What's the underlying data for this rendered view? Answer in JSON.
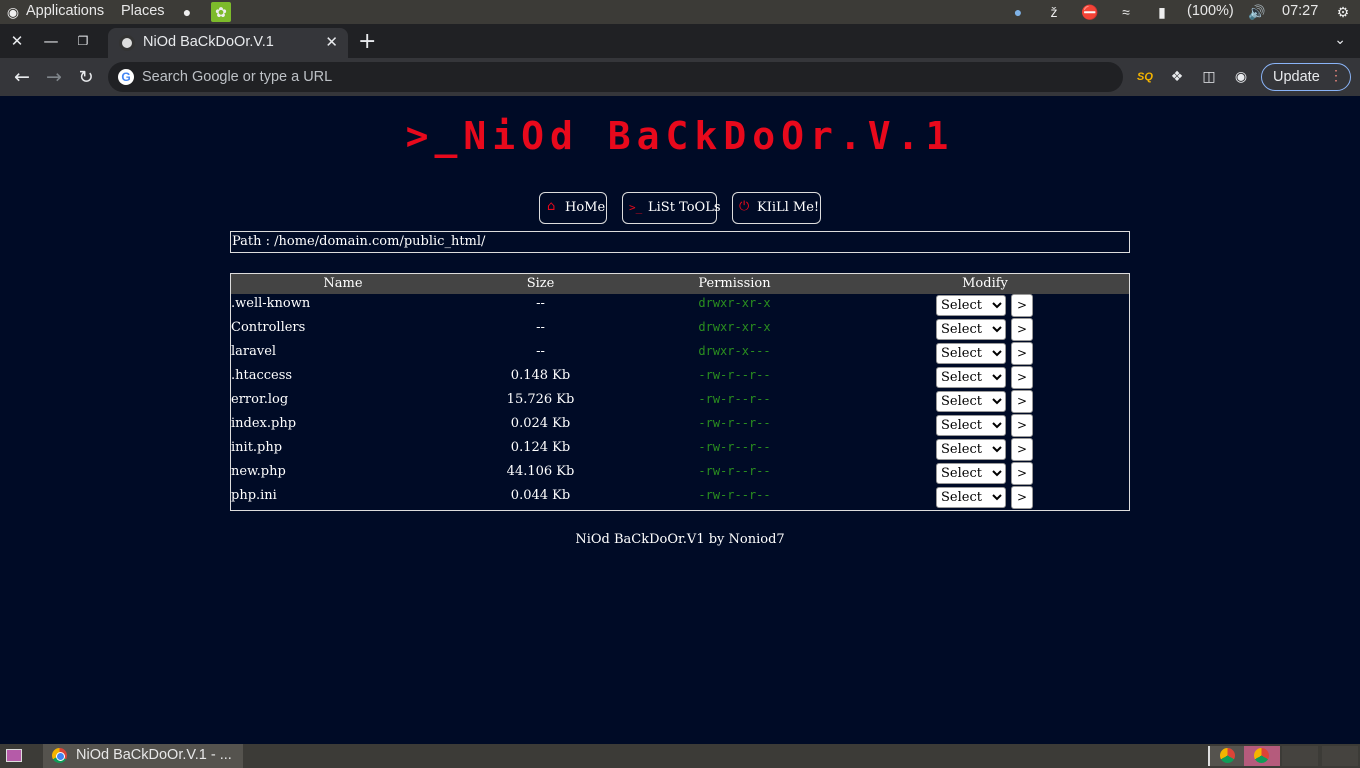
{
  "system_panel": {
    "applications_label": "Applications",
    "places_label": "Places",
    "battery_label": "(100%)",
    "clock": "07:27"
  },
  "browser": {
    "tab_title": "NiOd BaCkDoOr.V.1",
    "omnibox_placeholder": "Search Google or type a URL",
    "update_label": "Update",
    "extension_sq_label": "SQ"
  },
  "page": {
    "logo": ">_NiOd BaCkDoOr.V.1",
    "menu": [
      {
        "icon": "home-icon",
        "label": "HoMe"
      },
      {
        "icon": "terminal-icon",
        "label": "LiSt ToOLs"
      },
      {
        "icon": "power-icon",
        "label": "KIiLl Me!"
      }
    ],
    "path": "Path : /home/domain.com/public_html/",
    "table": {
      "headers": [
        "Name",
        "Size",
        "Permission",
        "Modify"
      ],
      "rows": [
        {
          "name": ".well-known",
          "size": "--",
          "perm": "drwxr-xr-x"
        },
        {
          "name": "Controllers",
          "size": "--",
          "perm": "drwxr-xr-x"
        },
        {
          "name": "laravel",
          "size": "--",
          "perm": "drwxr-x---"
        },
        {
          "name": ".htaccess",
          "size": "0.148 Kb",
          "perm": "-rw-r--r--"
        },
        {
          "name": "error.log",
          "size": "15.726 Kb",
          "perm": "-rw-r--r--"
        },
        {
          "name": "index.php",
          "size": "0.024 Kb",
          "perm": "-rw-r--r--"
        },
        {
          "name": "init.php",
          "size": "0.124 Kb",
          "perm": "-rw-r--r--"
        },
        {
          "name": "new.php",
          "size": "44.106 Kb",
          "perm": "-rw-r--r--"
        },
        {
          "name": "php.ini",
          "size": "0.044 Kb",
          "perm": "-rw-r--r--"
        }
      ],
      "select_label": "Select",
      "go_label": ">"
    },
    "footer": "NiOd BaCkDoOr.V1 by Noniod7"
  },
  "taskbar": {
    "window_title": "NiOd BaCkDoOr.V.1 - ..."
  },
  "colors": {
    "page_bg": "#000b26",
    "logo_red": "#e8091c",
    "permission_green": "#2a8f1f"
  }
}
